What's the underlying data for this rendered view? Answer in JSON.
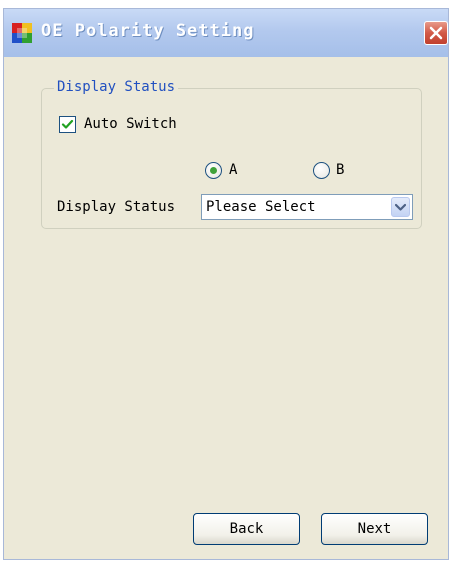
{
  "window": {
    "title": "OE Polarity Setting"
  },
  "group": {
    "title": "Display Status",
    "auto_switch": {
      "label": "Auto Switch",
      "checked": true
    },
    "radio_a": {
      "label": "A",
      "selected": true
    },
    "radio_b": {
      "label": "B",
      "selected": false
    },
    "display_status": {
      "label": "Display Status",
      "value": "Please Select"
    }
  },
  "buttons": {
    "back_label": "Back",
    "next_label": "Next"
  },
  "icons": {
    "app": "app-icon",
    "close": "close-icon",
    "checkbox_check": "check-icon",
    "dropdown": "chevron-down-icon"
  },
  "colors": {
    "titlebar": "#b3c9ee",
    "window_bg": "#ece9d8",
    "group_title": "#2150c0",
    "close_button": "#d25a48",
    "accent_check": "#3fa13a"
  }
}
